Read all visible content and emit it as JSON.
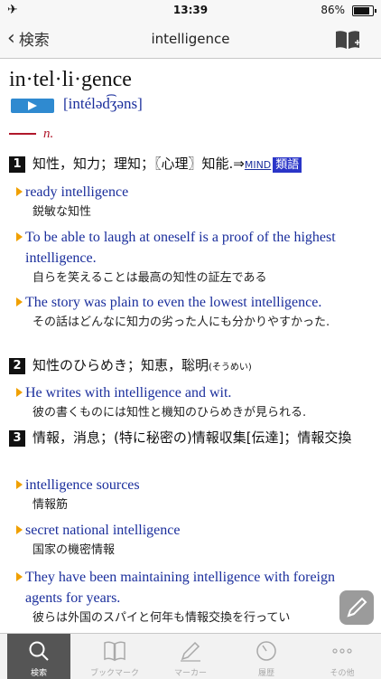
{
  "status": {
    "time": "13:39",
    "battery": "86%"
  },
  "nav": {
    "back_label": "検索",
    "title": "intelligence"
  },
  "entry": {
    "headword": "in·tel·li·gence",
    "pronunciation": "[intéləd͡ʒəns]",
    "pos": "n.",
    "senses": [
      {
        "number": "1",
        "definition": "知性，知力；理知；〖心理〗知能.⇒",
        "ref": "MIND",
        "badge": "類語",
        "examples": [
          {
            "en": "ready intelligence",
            "ja": "鋭敏な知性"
          },
          {
            "en": "To be able to laugh at oneself is a proof of the highest intelligence.",
            "ja": "自らを笑えることは最高の知性の証左である"
          },
          {
            "en": "The story was plain to even the lowest intelligence.",
            "ja": "その話はどんなに知力の劣った人にも分かりやすかった."
          }
        ]
      },
      {
        "number": "2",
        "definition": "知性のひらめき；知恵，聡明",
        "reading": "(そうめい)",
        "examples": [
          {
            "en": "He writes with intelligence and wit.",
            "ja": "彼の書くものには知性と機知のひらめきが見られる."
          }
        ]
      },
      {
        "number": "3",
        "definition": "情報，消息；(特に秘密の)情報収集[伝達]；情報交換",
        "examples": [
          {
            "en": "intelligence sources",
            "ja": "情報筋"
          },
          {
            "en": "secret national intelligence",
            "ja": "国家の機密情報"
          },
          {
            "en": "They have been maintaining intelligence with foreign agents for years.",
            "ja": "彼らは外国のスパイと何年も情報交換を行ってい"
          }
        ]
      }
    ]
  },
  "tabs": [
    {
      "label": "検索",
      "icon": "search-icon",
      "active": true
    },
    {
      "label": "ブックマーク",
      "icon": "book-icon",
      "active": false
    },
    {
      "label": "マーカー",
      "icon": "marker-icon",
      "active": false
    },
    {
      "label": "履歴",
      "icon": "history-icon",
      "active": false
    },
    {
      "label": "その他",
      "icon": "more-icon",
      "active": false
    }
  ],
  "colors": {
    "accent": "#1a2e9c",
    "pos": "#b0182b",
    "audio": "#2f8ad0",
    "badge": "#2a35c8",
    "bullet": "#f0a000"
  }
}
